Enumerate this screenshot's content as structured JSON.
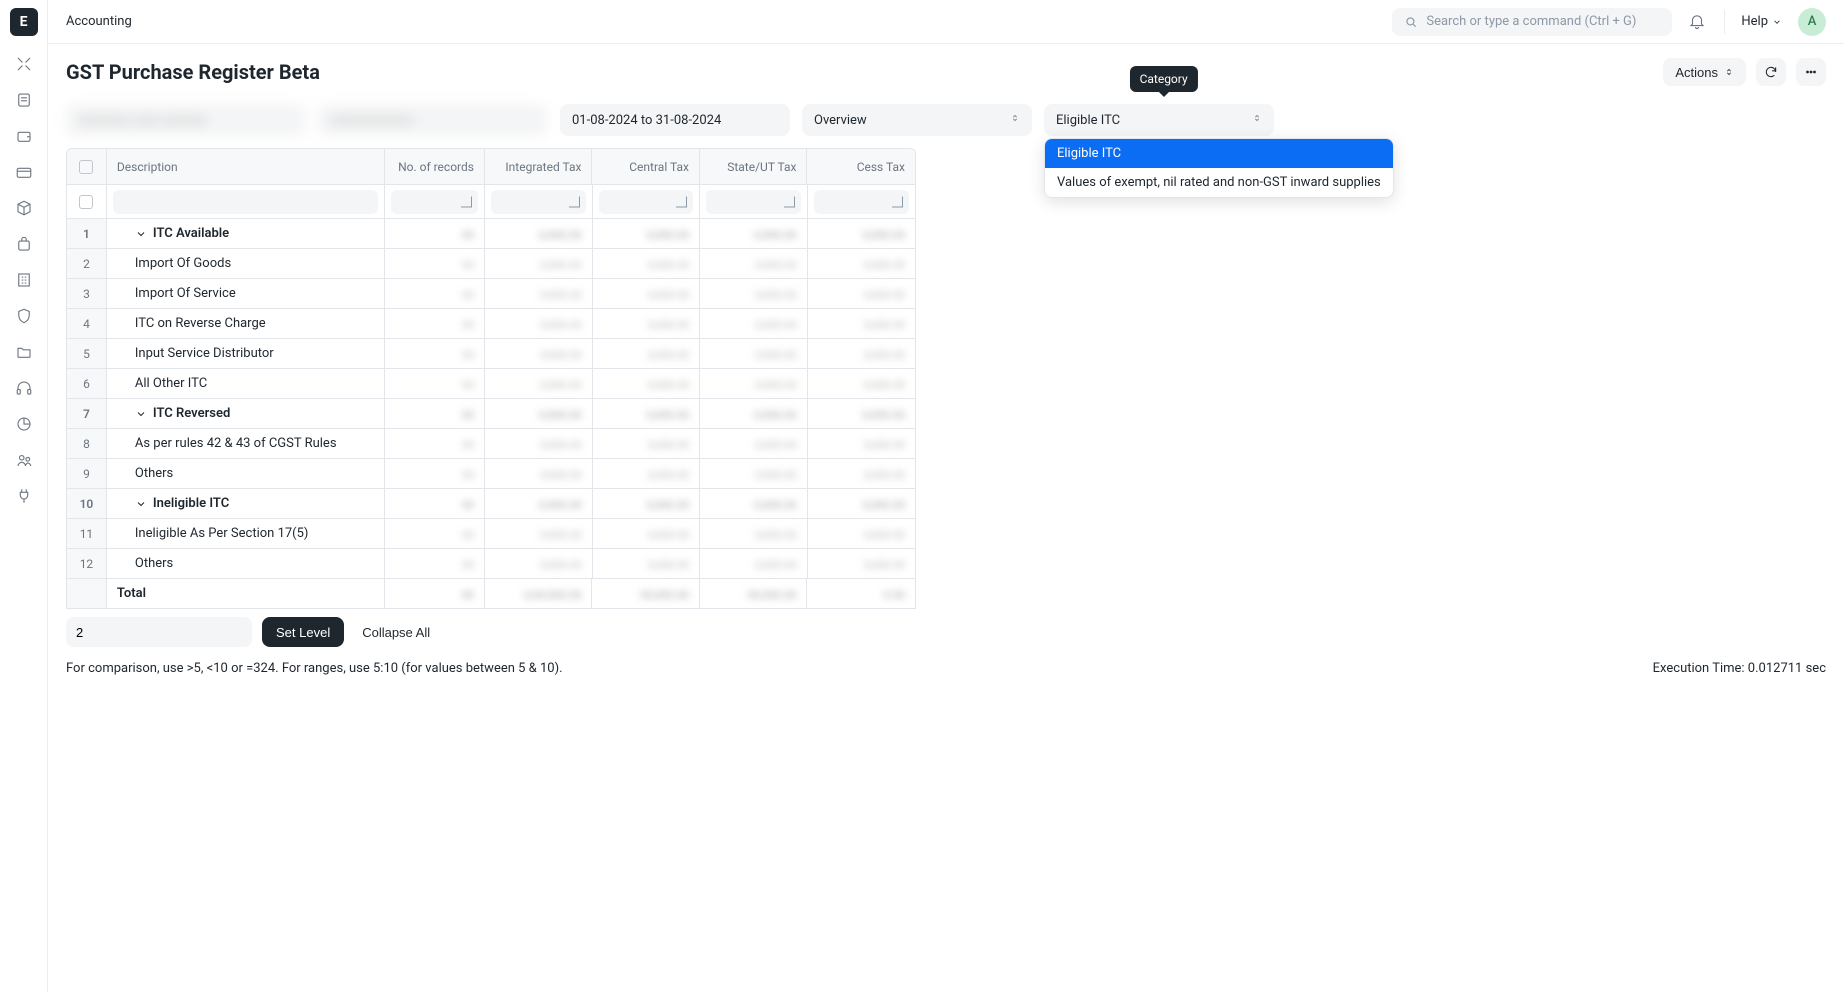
{
  "topbar": {
    "breadcrumb": "Accounting",
    "search_placeholder": "Search or type a command (Ctrl + G)",
    "help_label": "Help",
    "avatar_initial": "A"
  },
  "page": {
    "title": "GST Purchase Register Beta",
    "actions_label": "Actions"
  },
  "filters": {
    "date_range": "01-08-2024 to 31-08-2024",
    "overview": "Overview",
    "category_selected": "Eligible ITC",
    "tooltip": "Category",
    "dropdown": [
      "Eligible ITC",
      "Values of exempt, nil rated and non-GST inward supplies"
    ]
  },
  "columns": {
    "description": "Description",
    "records": "No. of records",
    "igst": "Integrated Tax",
    "cgst": "Central Tax",
    "sgst": "State/UT Tax",
    "cess": "Cess Tax"
  },
  "rows": [
    {
      "n": "1",
      "label": "ITC Available",
      "level": 1,
      "bold": true,
      "caret": true
    },
    {
      "n": "2",
      "label": "Import Of Goods",
      "level": 2,
      "bold": false,
      "caret": false
    },
    {
      "n": "3",
      "label": "Import Of Service",
      "level": 2,
      "bold": false,
      "caret": false
    },
    {
      "n": "4",
      "label": "ITC on Reverse Charge",
      "level": 2,
      "bold": false,
      "caret": false
    },
    {
      "n": "5",
      "label": "Input Service Distributor",
      "level": 2,
      "bold": false,
      "caret": false
    },
    {
      "n": "6",
      "label": "All Other ITC",
      "level": 2,
      "bold": false,
      "caret": false
    },
    {
      "n": "7",
      "label": "ITC Reversed",
      "level": 1,
      "bold": true,
      "caret": true
    },
    {
      "n": "8",
      "label": "As per rules 42 & 43 of CGST Rules",
      "level": 2,
      "bold": false,
      "caret": false
    },
    {
      "n": "9",
      "label": "Others",
      "level": 2,
      "bold": false,
      "caret": false
    },
    {
      "n": "10",
      "label": "Ineligible ITC",
      "level": 1,
      "bold": true,
      "caret": true
    },
    {
      "n": "11",
      "label": "Ineligible As Per Section 17(5)",
      "level": 2,
      "bold": false,
      "caret": false
    },
    {
      "n": "12",
      "label": "Others",
      "level": 2,
      "bold": false,
      "caret": false
    }
  ],
  "total_label": "Total",
  "footer": {
    "level_value": "2",
    "set_level": "Set Level",
    "collapse_all": "Collapse All",
    "hint": "For comparison, use >5, <10 or =324. For ranges, use 5:10 (for values between 5 & 10).",
    "exec_time": "Execution Time: 0.012711 sec"
  }
}
